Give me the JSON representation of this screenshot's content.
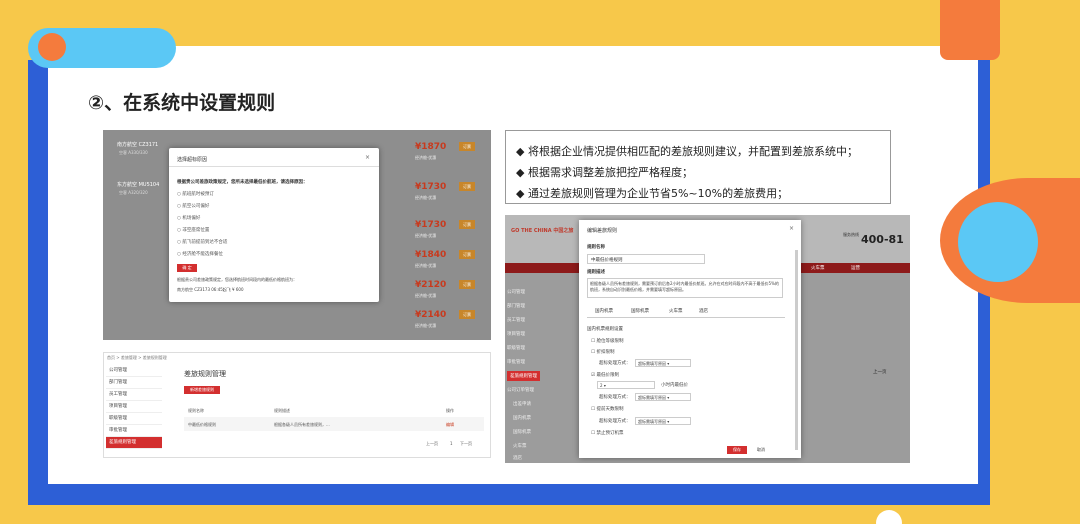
{
  "title": "②、在系统中设置规则",
  "bullets": [
    "◆  将根据企业情况提供相匹配的差旅规则建议，并配置到差旅系统中；",
    "◆  根据需求调整差旅把控严格程度；",
    "◆  通过差旅规则管理为企业节省5%~10%的差旅费用；"
  ],
  "shot1": {
    "flights": [
      {
        "airline": "南方航空 CZ3171",
        "flight_no": "空客 A330/330",
        "price": "¥1870",
        "note": "经济舱·优惠",
        "book": "订票"
      },
      {
        "airline": "东方航空 MU5104",
        "flight_no": "空客 A320/320",
        "price": "¥1730",
        "note": "经济舱·优惠",
        "book": "订票"
      },
      {
        "airline": "",
        "flight_no": "",
        "price": "¥1730",
        "note": "经济舱·优惠",
        "book": "订票"
      },
      {
        "airline": "",
        "flight_no": "",
        "price": "¥1840",
        "note": "经济舱·优惠",
        "book": "订票"
      },
      {
        "airline": "",
        "flight_no": "",
        "price": "¥2120",
        "note": "经济舱·优惠",
        "book": "订票"
      },
      {
        "airline": "",
        "flight_no": "",
        "price": "¥2140",
        "note": "经济舱·优惠",
        "book": "订票"
      }
    ],
    "dialog": {
      "title": "选择超标原因",
      "close": "×",
      "question": "根据贵公司差旅政策规定，您所未选择最低价航班，请选择原因：",
      "options": [
        "○ 航班航时被预订",
        "○ 航空公司偏好",
        "○ 机场偏好",
        "○ 非空座席位置",
        "○ 航飞前提前到达不合适",
        "○ 经济舱不能选择餐位"
      ],
      "confirm": "确 定",
      "note1": "根据贵公司差旅政策规定，您选择航班时间段内的最低价格航班为：",
      "note2": "南方航空 CZ3173 06:45起飞 ¥ 600"
    }
  },
  "shot2": {
    "breadcrumb": "首页 > 差旅管理 > 差旅规则管理",
    "sidebar": [
      "公司管理",
      "部门管理",
      "员工管理",
      "项目管理",
      "职级管理",
      "审批管理",
      "差旅规则管理"
    ],
    "page_title": "差旅规则管理",
    "add_button": "新增差旅规则",
    "columns": [
      "规则名称",
      "规则描述",
      "操作"
    ],
    "row": [
      "中最低价格规则",
      "根据各级人员所有差旅规则，...",
      "编辑"
    ],
    "pager": [
      "上一页",
      "1",
      "下一页"
    ]
  },
  "shot3": {
    "logo": "GO THE CHINA 中国之旅",
    "hotline_label": "服务热线",
    "hotline": "400-81",
    "nav": [
      "火车票",
      "运营"
    ],
    "sidebar": [
      "公司管理",
      "部门管理",
      "员工管理",
      "项目管理",
      "职级管理",
      "审批管理",
      "差旅规则管理",
      "公司订单管理",
      "出差申请",
      "国内机票",
      "国际机票",
      "火车票",
      "酒店"
    ],
    "more": "上一页",
    "modal": {
      "title": "编辑差旅规则",
      "close": "×",
      "name_label": "规则名称",
      "name_value": "中最低价格规则",
      "desc_label": "规则描述",
      "desc_value": "根据各级人员所有差旅规则，需要预订前后各2小时内最低价航班。允许在对应时间段内不高于最低价5%的航班，系统自动识别最低价格，并需要填写超标原因。",
      "tabs": [
        "国内机票",
        "国际机票",
        "火车票",
        "酒店"
      ],
      "section": "国内机票规则设置",
      "rule1": "☐ 舱位等级限制",
      "rule2": "☐ 折扣限制",
      "handle_label": "超标处理方式：",
      "handle_value": "超标需填写原因 ▾",
      "rule3": "☑ 最低价限制",
      "hours_value": "2 ▾",
      "hours_label": "小时内最低价",
      "rule4": "☐ 提前天数限制",
      "rule5": "☐ 禁止预订机票",
      "save": "保存",
      "cancel": "取消"
    }
  }
}
